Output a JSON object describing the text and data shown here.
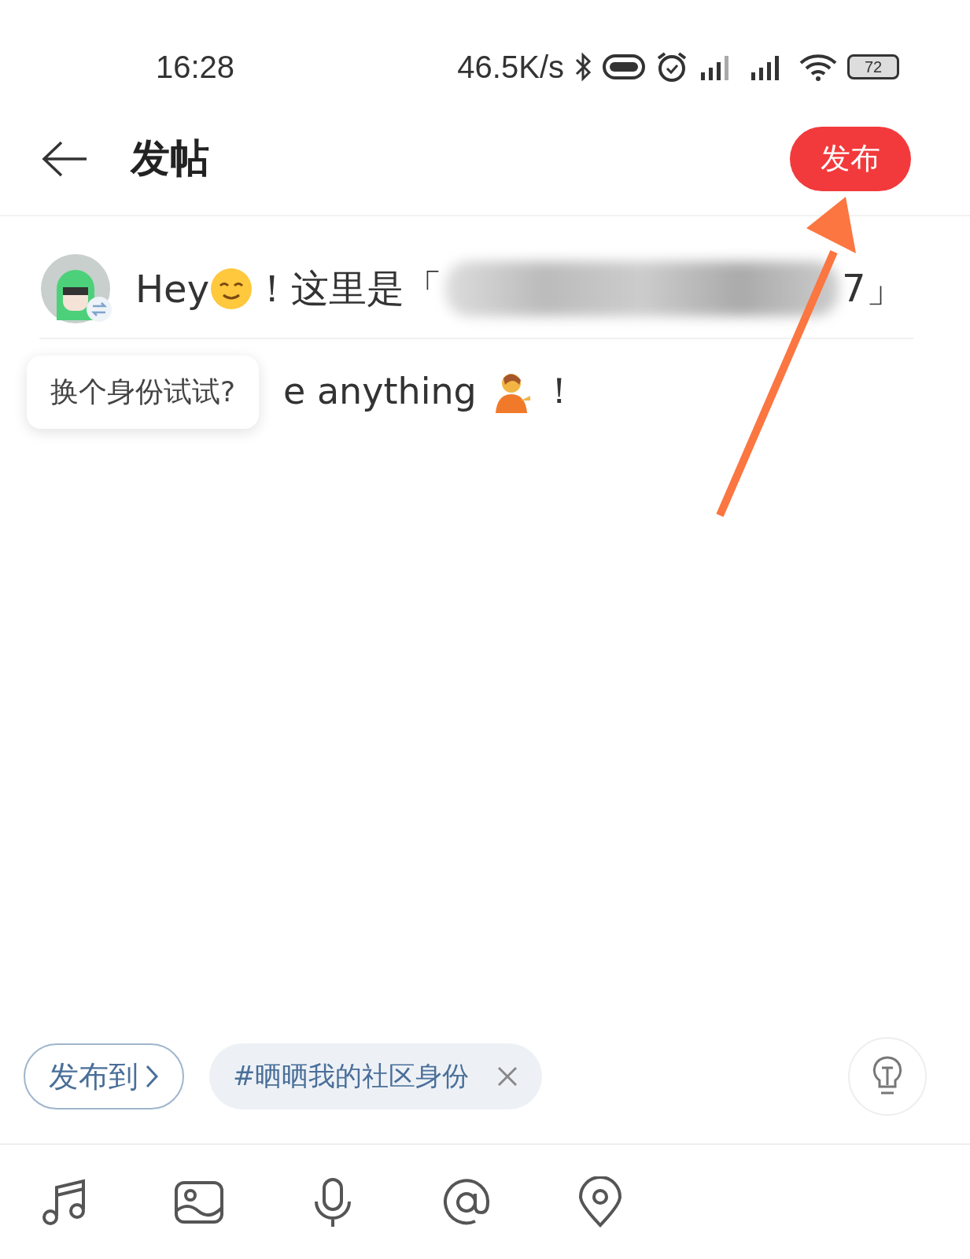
{
  "status_bar": {
    "time": "16:28",
    "speed": "46.5K/s",
    "battery": "72"
  },
  "header": {
    "title": "发帖",
    "publish_button": "发布"
  },
  "title_line": {
    "prefix": "Hey",
    "middle": "！这里是「",
    "suffix": "7」"
  },
  "body_line": {
    "text": "e anything",
    "end": "！"
  },
  "tooltip": {
    "text": "换个身份试试?"
  },
  "chips": [
    {
      "kind": "target",
      "label": "发布到"
    },
    {
      "kind": "topic",
      "label": "#晒晒我的社区身份"
    }
  ],
  "toolbar": [
    {
      "kind": "music"
    },
    {
      "kind": "image"
    },
    {
      "kind": "mic"
    },
    {
      "kind": "at"
    },
    {
      "kind": "location"
    }
  ],
  "annotation": {
    "kind": "arrow"
  }
}
